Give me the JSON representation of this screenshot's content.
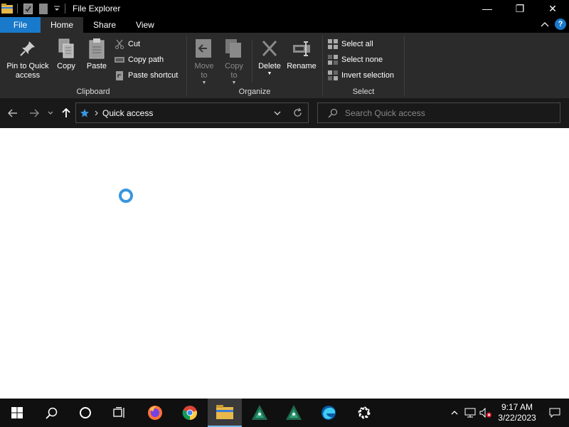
{
  "window": {
    "title": "File Explorer",
    "minimize_glyph": "—",
    "maximize_glyph": "❐",
    "close_glyph": "✕"
  },
  "tabs": [
    {
      "label": "File",
      "active": false
    },
    {
      "label": "Home",
      "active": true
    },
    {
      "label": "Share",
      "active": false
    },
    {
      "label": "View",
      "active": false
    }
  ],
  "ribbon": {
    "clipboard": {
      "label": "Clipboard",
      "pin_label_1": "Pin to Quick",
      "pin_label_2": "access",
      "copy_label": "Copy",
      "paste_label": "Paste",
      "cut_label": "Cut",
      "copy_path_label": "Copy path",
      "paste_shortcut_label": "Paste shortcut"
    },
    "organize": {
      "label": "Organize",
      "move_to_1": "Move",
      "move_to_2": "to",
      "copy_to_1": "Copy",
      "copy_to_2": "to",
      "delete_label": "Delete",
      "rename_label": "Rename"
    },
    "select": {
      "label": "Select",
      "select_all": "Select all",
      "select_none": "Select none",
      "invert_selection": "Invert selection"
    }
  },
  "navigation": {
    "address": "Quick access",
    "search_placeholder": "Search Quick access"
  },
  "taskbar": {
    "time": "9:17 AM",
    "date": "3/22/2023",
    "active_app": "file-explorer"
  },
  "colors": {
    "accent": "#1979ca",
    "spinner": "#3a96dd",
    "taskbar_highlight": "#76b9ed"
  }
}
